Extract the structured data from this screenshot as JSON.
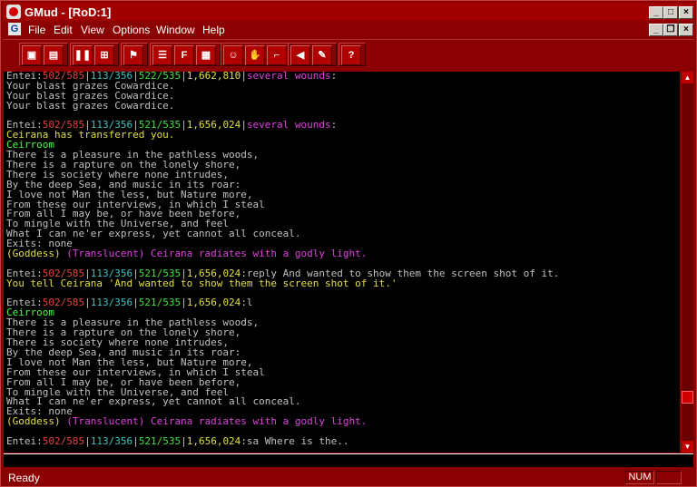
{
  "window": {
    "title": "GMud - [RoD:1]"
  },
  "menubar": {
    "items": [
      "File",
      "Edit",
      "View",
      "Options",
      "Window",
      "Help"
    ]
  },
  "toolbar": {
    "buttons": [
      {
        "name": "connect-button",
        "icon": "connect-icon",
        "glyph": "▣"
      },
      {
        "name": "disconnect-button",
        "icon": "disconnect-icon",
        "glyph": "▤"
      },
      {
        "name": "pause-button",
        "icon": "pause-icon",
        "glyph": "❚❚"
      },
      {
        "name": "grid-button",
        "icon": "grid-icon",
        "glyph": "⊞"
      },
      {
        "name": "script-button",
        "icon": "script-icon",
        "glyph": "⚑"
      },
      {
        "name": "log-button",
        "icon": "log-icon",
        "glyph": "☰"
      },
      {
        "name": "font-button",
        "icon": "font-icon",
        "glyph": "F"
      },
      {
        "name": "ansi-button",
        "icon": "ansi-icon",
        "glyph": "▦"
      },
      {
        "name": "smiley-button",
        "icon": "smiley-icon",
        "glyph": "☺"
      },
      {
        "name": "hand-button",
        "icon": "hand-icon",
        "glyph": "✋"
      },
      {
        "name": "gun-button",
        "icon": "gun-icon",
        "glyph": "⌐"
      },
      {
        "name": "sound-button",
        "icon": "speaker-icon",
        "glyph": "◀"
      },
      {
        "name": "pen-button",
        "icon": "pen-icon",
        "glyph": "✎"
      },
      {
        "name": "help-button",
        "icon": "question-icon",
        "glyph": "?"
      }
    ]
  },
  "terminal": {
    "lines": [
      [
        [
          "Entei:",
          "g"
        ],
        [
          "502/585",
          "r"
        ],
        [
          "|",
          "g"
        ],
        [
          "113/356",
          "c"
        ],
        [
          "|",
          "g"
        ],
        [
          "522/535",
          "gr"
        ],
        [
          "|",
          "g"
        ],
        [
          "1,662,810",
          "y"
        ],
        [
          "|",
          "g"
        ],
        [
          "several wounds",
          "m"
        ],
        [
          ":",
          "g"
        ]
      ],
      [
        [
          "Your blast grazes Cowardice.",
          "g"
        ]
      ],
      [
        [
          "Your blast grazes Cowardice.",
          "g"
        ]
      ],
      [
        [
          "Your blast grazes Cowardice.",
          "g"
        ]
      ],
      [],
      [
        [
          "Entei:",
          "g"
        ],
        [
          "502/585",
          "r"
        ],
        [
          "|",
          "g"
        ],
        [
          "113/356",
          "c"
        ],
        [
          "|",
          "g"
        ],
        [
          "521/535",
          "gr"
        ],
        [
          "|",
          "g"
        ],
        [
          "1,656,024",
          "y"
        ],
        [
          "|",
          "g"
        ],
        [
          "several wounds",
          "m"
        ],
        [
          ":",
          "g"
        ]
      ],
      [
        [
          "Ceirana has transferred you.",
          "y"
        ]
      ],
      [
        [
          "Ceirroom",
          "lg"
        ]
      ],
      [
        [
          "There is a pleasure in the pathless woods,",
          "g"
        ]
      ],
      [
        [
          "There is a rapture on the lonely shore,",
          "g"
        ]
      ],
      [
        [
          "There is society where none intrudes,",
          "g"
        ]
      ],
      [
        [
          "By the deep Sea, and music in its roar:",
          "g"
        ]
      ],
      [
        [
          "I love not Man the less, but Nature more,",
          "g"
        ]
      ],
      [
        [
          "From these our interviews, in which I steal",
          "g"
        ]
      ],
      [
        [
          "From all I may be, or have been before,",
          "g"
        ]
      ],
      [
        [
          "To mingle with the Universe, and feel",
          "g"
        ]
      ],
      [
        [
          "What I can ne'er express, yet cannot all conceal.",
          "g"
        ]
      ],
      [
        [
          "Exits: none",
          "g"
        ]
      ],
      [
        [
          "(Goddess)",
          "y"
        ],
        [
          " (Translucent) Ceirana radiates with a godly light.",
          "m"
        ]
      ],
      [],
      [
        [
          "Entei:",
          "g"
        ],
        [
          "502/585",
          "r"
        ],
        [
          "|",
          "g"
        ],
        [
          "113/356",
          "c"
        ],
        [
          "|",
          "g"
        ],
        [
          "521/535",
          "gr"
        ],
        [
          "|",
          "g"
        ],
        [
          "1,656,024",
          "y"
        ],
        [
          ":reply And wanted to show them the screen shot of it.",
          "g"
        ]
      ],
      [
        [
          "You tell Ceirana 'And wanted to show them the screen shot of it.'",
          "y"
        ]
      ],
      [],
      [
        [
          "Entei:",
          "g"
        ],
        [
          "502/585",
          "r"
        ],
        [
          "|",
          "g"
        ],
        [
          "113/356",
          "c"
        ],
        [
          "|",
          "g"
        ],
        [
          "521/535",
          "gr"
        ],
        [
          "|",
          "g"
        ],
        [
          "1,656,024",
          "y"
        ],
        [
          ":l",
          "g"
        ]
      ],
      [
        [
          "Ceirroom",
          "lg"
        ]
      ],
      [
        [
          "There is a pleasure in the pathless woods,",
          "g"
        ]
      ],
      [
        [
          "There is a rapture on the lonely shore,",
          "g"
        ]
      ],
      [
        [
          "There is society where none intrudes,",
          "g"
        ]
      ],
      [
        [
          "By the deep Sea, and music in its roar:",
          "g"
        ]
      ],
      [
        [
          "I love not Man the less, but Nature more,",
          "g"
        ]
      ],
      [
        [
          "From these our interviews, in which I steal",
          "g"
        ]
      ],
      [
        [
          "From all I may be, or have been before,",
          "g"
        ]
      ],
      [
        [
          "To mingle with the Universe, and feel",
          "g"
        ]
      ],
      [
        [
          "What I can ne'er express, yet cannot all conceal.",
          "g"
        ]
      ],
      [
        [
          "Exits: none",
          "g"
        ]
      ],
      [
        [
          "(Goddess)",
          "y"
        ],
        [
          " (Translucent) Ceirana radiates with a godly light.",
          "m"
        ]
      ],
      [],
      [
        [
          "Entei:",
          "g"
        ],
        [
          "502/585",
          "r"
        ],
        [
          "|",
          "g"
        ],
        [
          "113/356",
          "c"
        ],
        [
          "|",
          "g"
        ],
        [
          "521/535",
          "gr"
        ],
        [
          "|",
          "g"
        ],
        [
          "1,656,024",
          "y"
        ],
        [
          ":sa Where is the..",
          "g"
        ]
      ]
    ]
  },
  "statusbar": {
    "ready": "Ready",
    "num": "NUM"
  }
}
